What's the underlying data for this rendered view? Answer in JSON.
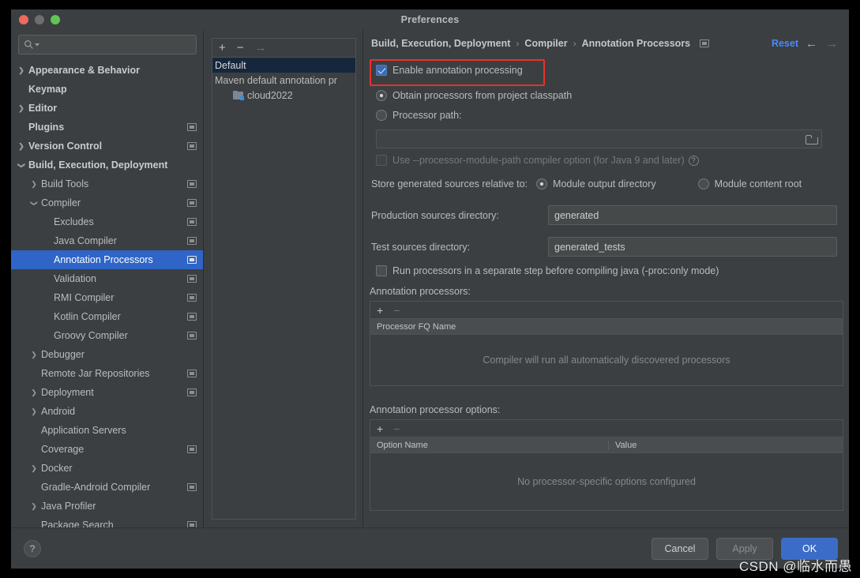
{
  "window": {
    "title": "Preferences"
  },
  "search": {
    "placeholder": "",
    "icon": "search-icon"
  },
  "sidebar": {
    "items": [
      {
        "label": "Appearance & Behavior",
        "level": 0,
        "chevron": "right",
        "bold": true,
        "scope": false,
        "selected": false
      },
      {
        "label": "Keymap",
        "level": 0,
        "chevron": "",
        "bold": true,
        "scope": false,
        "selected": false
      },
      {
        "label": "Editor",
        "level": 0,
        "chevron": "right",
        "bold": true,
        "scope": false,
        "selected": false
      },
      {
        "label": "Plugins",
        "level": 0,
        "chevron": "",
        "bold": true,
        "scope": true,
        "selected": false
      },
      {
        "label": "Version Control",
        "level": 0,
        "chevron": "right",
        "bold": true,
        "scope": true,
        "selected": false
      },
      {
        "label": "Build, Execution, Deployment",
        "level": 0,
        "chevron": "down",
        "bold": true,
        "scope": false,
        "selected": false
      },
      {
        "label": "Build Tools",
        "level": 1,
        "chevron": "right",
        "bold": false,
        "scope": true,
        "selected": false
      },
      {
        "label": "Compiler",
        "level": 1,
        "chevron": "down",
        "bold": false,
        "scope": true,
        "selected": false
      },
      {
        "label": "Excludes",
        "level": 2,
        "chevron": "",
        "bold": false,
        "scope": true,
        "selected": false
      },
      {
        "label": "Java Compiler",
        "level": 2,
        "chevron": "",
        "bold": false,
        "scope": true,
        "selected": false
      },
      {
        "label": "Annotation Processors",
        "level": 2,
        "chevron": "",
        "bold": false,
        "scope": true,
        "selected": true
      },
      {
        "label": "Validation",
        "level": 2,
        "chevron": "",
        "bold": false,
        "scope": true,
        "selected": false
      },
      {
        "label": "RMI Compiler",
        "level": 2,
        "chevron": "",
        "bold": false,
        "scope": true,
        "selected": false
      },
      {
        "label": "Kotlin Compiler",
        "level": 2,
        "chevron": "",
        "bold": false,
        "scope": true,
        "selected": false
      },
      {
        "label": "Groovy Compiler",
        "level": 2,
        "chevron": "",
        "bold": false,
        "scope": true,
        "selected": false
      },
      {
        "label": "Debugger",
        "level": 1,
        "chevron": "right",
        "bold": false,
        "scope": false,
        "selected": false
      },
      {
        "label": "Remote Jar Repositories",
        "level": 1,
        "chevron": "",
        "bold": false,
        "scope": true,
        "selected": false
      },
      {
        "label": "Deployment",
        "level": 1,
        "chevron": "right",
        "bold": false,
        "scope": true,
        "selected": false
      },
      {
        "label": "Android",
        "level": 1,
        "chevron": "right",
        "bold": false,
        "scope": false,
        "selected": false
      },
      {
        "label": "Application Servers",
        "level": 1,
        "chevron": "",
        "bold": false,
        "scope": false,
        "selected": false
      },
      {
        "label": "Coverage",
        "level": 1,
        "chevron": "",
        "bold": false,
        "scope": true,
        "selected": false
      },
      {
        "label": "Docker",
        "level": 1,
        "chevron": "right",
        "bold": false,
        "scope": false,
        "selected": false
      },
      {
        "label": "Gradle-Android Compiler",
        "level": 1,
        "chevron": "",
        "bold": false,
        "scope": true,
        "selected": false
      },
      {
        "label": "Java Profiler",
        "level": 1,
        "chevron": "right",
        "bold": false,
        "scope": false,
        "selected": false
      },
      {
        "label": "Package Search",
        "level": 1,
        "chevron": "",
        "bold": false,
        "scope": true,
        "selected": false
      }
    ]
  },
  "module_panel": {
    "toolbar": {
      "add": "+",
      "remove": "−",
      "move": "→"
    },
    "items": [
      {
        "label": "Default",
        "selected": true,
        "indent": false,
        "icon": false
      },
      {
        "label": "Maven default annotation pr",
        "selected": false,
        "indent": false,
        "icon": false
      },
      {
        "label": "cloud2022",
        "selected": false,
        "indent": true,
        "icon": true
      }
    ]
  },
  "breadcrumb": {
    "parts": [
      "Build, Execution, Deployment",
      "Compiler",
      "Annotation Processors"
    ],
    "separator": "›",
    "scope_icon": "project-scope-icon",
    "reset_label": "Reset",
    "back_icon": "←",
    "forward_icon": "→"
  },
  "settings": {
    "enable_annotation_processing": {
      "label": "Enable annotation processing",
      "checked": true,
      "highlighted": true
    },
    "obtain_from_classpath": {
      "label": "Obtain processors from project classpath",
      "selected": true
    },
    "processor_path": {
      "label": "Processor path:",
      "selected": false,
      "value": "",
      "browse_icon": "folder-icon"
    },
    "use_module_path": {
      "label": "Use --processor-module-path compiler option (for Java 9 and later)",
      "checked": false,
      "disabled": true,
      "help_icon": "?"
    },
    "store_relative": {
      "label": "Store generated sources relative to:",
      "options": [
        {
          "label": "Module output directory",
          "selected": true
        },
        {
          "label": "Module content root",
          "selected": false
        }
      ]
    },
    "production_sources": {
      "label": "Production sources directory:",
      "value": "generated"
    },
    "test_sources": {
      "label": "Test sources directory:",
      "value": "generated_tests"
    },
    "separate_step": {
      "label": "Run processors in a separate step before compiling java (-proc:only mode)",
      "checked": false
    }
  },
  "processors_table": {
    "title": "Annotation processors:",
    "toolbar": {
      "add": "+",
      "remove": "−"
    },
    "columns": [
      "Processor FQ Name"
    ],
    "rows": [],
    "empty_text": "Compiler will run all automatically discovered processors"
  },
  "options_table": {
    "title": "Annotation processor options:",
    "toolbar": {
      "add": "+",
      "remove": "−"
    },
    "columns": [
      "Option Name",
      "Value"
    ],
    "rows": [],
    "empty_text": "No processor-specific options configured"
  },
  "footer": {
    "help": "?",
    "cancel": "Cancel",
    "apply": "Apply",
    "ok": "OK"
  },
  "watermark": {
    "text": "CSDN @临水而愚"
  },
  "colors": {
    "window_bg": "#3c3f41",
    "accent_selection": "#2f65c7",
    "link_blue": "#4a88f7",
    "primary_button": "#3b6cc7",
    "highlight_red": "#e8312a",
    "module_badge": "#3592e0"
  }
}
